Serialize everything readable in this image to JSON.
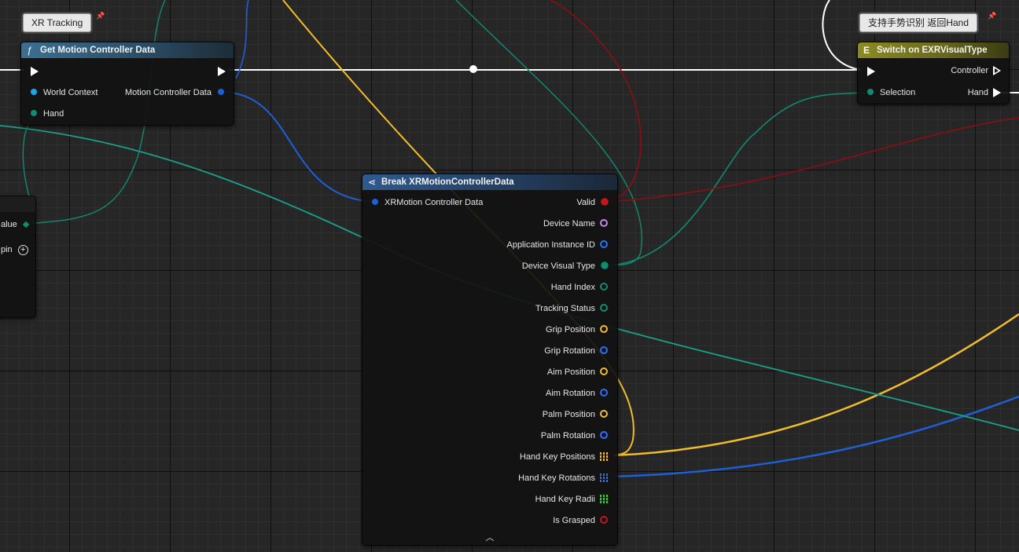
{
  "comments": {
    "xr_tracking": "XR Tracking",
    "hand_recognition": "支持手势识别 返回Hand"
  },
  "get_motion_controller_data": {
    "title": "Get Motion Controller Data",
    "icon": "ƒ",
    "inputs": [
      "World Context",
      "Hand"
    ],
    "output": "Motion Controller Data"
  },
  "partial_node": {
    "rows": [
      "alue",
      "pin"
    ]
  },
  "break_node": {
    "title": "Break XRMotionControllerData",
    "input": "XRMotion Controller Data",
    "outputs": [
      {
        "label": "Valid",
        "color": "#c3161c",
        "kind": "filled"
      },
      {
        "label": "Device Name",
        "color": "#c685e8",
        "kind": "ring"
      },
      {
        "label": "Application Instance ID",
        "color": "#2a6fff",
        "kind": "ring"
      },
      {
        "label": "Device Visual Type",
        "color": "#0f8c72",
        "kind": "filled"
      },
      {
        "label": "Hand Index",
        "color": "#0f8c72",
        "kind": "ring"
      },
      {
        "label": "Tracking Status",
        "color": "#0f8c72",
        "kind": "ring"
      },
      {
        "label": "Grip Position",
        "color": "#f1bd2b",
        "kind": "ring"
      },
      {
        "label": "Grip Rotation",
        "color": "#2a6fff",
        "kind": "ring"
      },
      {
        "label": "Aim Position",
        "color": "#f1bd2b",
        "kind": "ring"
      },
      {
        "label": "Aim Rotation",
        "color": "#2a6fff",
        "kind": "ring"
      },
      {
        "label": "Palm Position",
        "color": "#f1bd2b",
        "kind": "ring"
      },
      {
        "label": "Palm Rotation",
        "color": "#2a6fff",
        "kind": "ring"
      },
      {
        "label": "Hand Key Positions",
        "color": "#f1bd2b",
        "kind": "array"
      },
      {
        "label": "Hand Key Rotations",
        "color": "#2a6fff",
        "kind": "array"
      },
      {
        "label": "Hand Key Radii",
        "color": "#3bd13b",
        "kind": "array"
      },
      {
        "label": "Is Grasped",
        "color": "#c3161c",
        "kind": "ring"
      }
    ]
  },
  "switch_node": {
    "title": "Switch on EXRVisualType",
    "icon": "E",
    "inputs": [
      "Selection"
    ],
    "outputs": [
      "Controller",
      "Hand"
    ]
  },
  "colors": {
    "exec_wire": "#ffffff",
    "struct_wire": "#1f5fd6",
    "teal_wire": "#1aa08a",
    "vector_wire": "#f1bd2b",
    "bool_wire": "#8b0f12"
  }
}
